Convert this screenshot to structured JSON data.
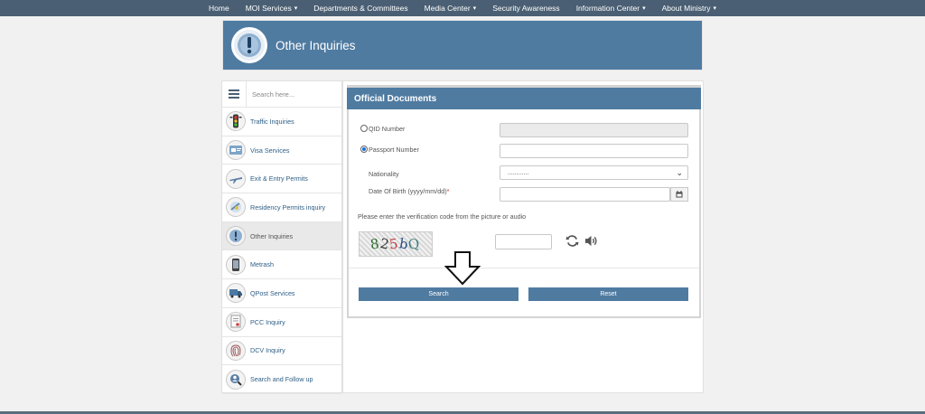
{
  "topnav": {
    "items": [
      {
        "label": "Home",
        "has_caret": false
      },
      {
        "label": "MOI Services",
        "has_caret": true
      },
      {
        "label": "Departments & Committees",
        "has_caret": false
      },
      {
        "label": "Media Center",
        "has_caret": true
      },
      {
        "label": "Security Awareness",
        "has_caret": false
      },
      {
        "label": "Information Center",
        "has_caret": true
      },
      {
        "label": "About Ministry",
        "has_caret": true
      }
    ],
    "caret": "▾"
  },
  "banner": {
    "title": "Other Inquiries",
    "icon": "exclamation-icon"
  },
  "sidebar": {
    "search_placeholder": "Search here...",
    "items": [
      {
        "label": "Traffic Inquiries",
        "icon": "traffic-light-icon",
        "active": false
      },
      {
        "label": "Visa Services",
        "icon": "visa-icon",
        "active": false
      },
      {
        "label": "Exit & Entry Permits",
        "icon": "airplane-icon",
        "active": false
      },
      {
        "label": "Residency Permits inquiry",
        "icon": "residency-icon",
        "active": false
      },
      {
        "label": "Other Inquiries",
        "icon": "exclamation-icon",
        "active": true
      },
      {
        "label": "Metrash",
        "icon": "phone-icon",
        "active": false
      },
      {
        "label": "QPost Services",
        "icon": "truck-icon",
        "active": false
      },
      {
        "label": "PCC Inquiry",
        "icon": "certificate-icon",
        "active": false
      },
      {
        "label": "DCV Inquiry",
        "icon": "fingerprint-icon",
        "active": false
      },
      {
        "label": "Search and Follow up",
        "icon": "person-search-icon",
        "active": false
      }
    ]
  },
  "form": {
    "title": "Official Documents",
    "qid_label": "QID Number",
    "qid_value": "",
    "passport_label": "Passport Number",
    "passport_value": "",
    "selected_option": "passport",
    "nationality_label": "Nationality",
    "nationality_value": "............",
    "dob_label": "Date Of Birth (yyyy/mm/dd)",
    "dob_required_mark": "*",
    "dob_value": "",
    "captcha_instruction": "Please enter the verification code from the picture or audio",
    "captcha_chars": [
      "8",
      "2",
      "5",
      "b",
      "Q"
    ],
    "captcha_input": "",
    "search_label": "Search",
    "reset_label": "Reset"
  },
  "colors": {
    "nav_bg": "#4a5f73",
    "accent": "#4f7ba1",
    "link": "#2e5f86",
    "required": "#d9232e"
  }
}
